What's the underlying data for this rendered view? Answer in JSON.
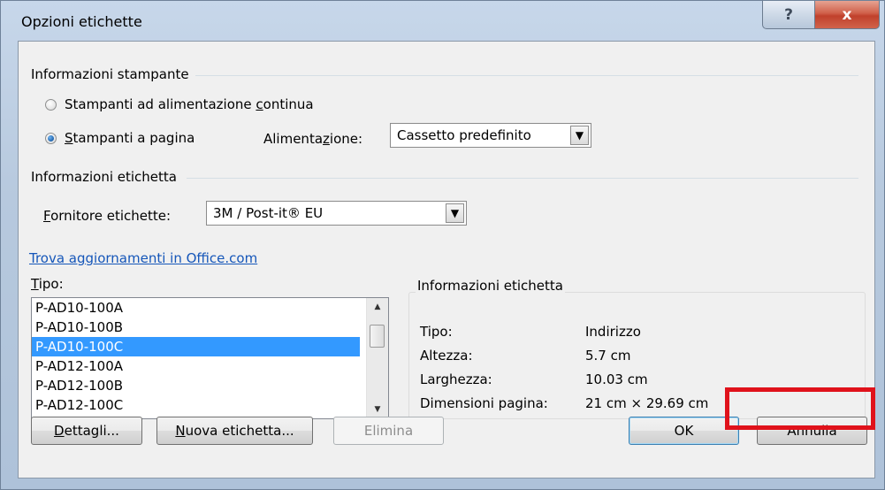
{
  "window": {
    "title": "Opzioni etichette"
  },
  "titlebar": {
    "help_glyph": "?",
    "close_glyph": "x"
  },
  "printer_info": {
    "heading": "Informazioni stampante",
    "options": [
      {
        "label": "Stampanti ad alimentazione continua",
        "checked": false
      },
      {
        "label": "Stampanti a pagina",
        "checked": true
      }
    ],
    "tray_label": "Alimentazione:",
    "tray_value": "Cassetto predefinito"
  },
  "label_info": {
    "heading": "Informazioni etichetta",
    "vendor_label": "Fornitore etichette:",
    "vendor_value": "3M / Post-it® EU"
  },
  "update_link": "Trova aggiornamenti in Office.com",
  "product": {
    "label": "Tipo:",
    "items": [
      "P-AD10-100A",
      "P-AD10-100B",
      "P-AD10-100C",
      "P-AD12-100A",
      "P-AD12-100B",
      "P-AD12-100C"
    ],
    "selected_index": 2
  },
  "details": {
    "heading": "Informazioni etichetta",
    "rows": [
      {
        "key": "Tipo:",
        "value": "Indirizzo"
      },
      {
        "key": "Altezza:",
        "value": "5.7 cm"
      },
      {
        "key": "Larghezza:",
        "value": "10.03 cm"
      },
      {
        "key": "Dimensioni pagina:",
        "value": "21 cm × 29.69 cm"
      }
    ]
  },
  "buttons": {
    "details": "Dettagli...",
    "new_label": "Nuova etichetta...",
    "delete": "Elimina",
    "ok": "OK",
    "cancel": "Annulla"
  },
  "colors": {
    "selection": "#3399ff",
    "link": "#1556b9",
    "highlight": "#e0121b"
  },
  "icons": {
    "help": "help-icon",
    "close": "close-icon",
    "dropdown": "chevron-down-icon"
  }
}
